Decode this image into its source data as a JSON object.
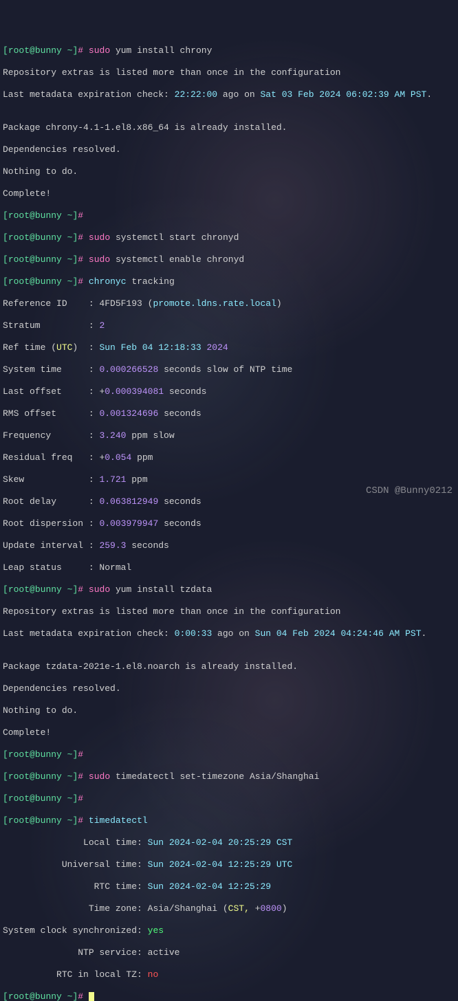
{
  "prompt": {
    "user": "root",
    "host": "bunny",
    "dir": "~",
    "mark": "#"
  },
  "cmd1": {
    "sudo": "sudo",
    "rest": " yum install chrony"
  },
  "out1": {
    "l1": "Repository extras is listed more than once in the configuration",
    "l2a": "Last metadata expiration check: ",
    "l2b": "22:22:00",
    "l2c": " ago on ",
    "l2d": "Sat 03 Feb 2024 06:02:39 AM PST",
    "l2e": ".",
    "l3": "",
    "l4": "Package chrony-4.1-1.el8.x86_64 is already installed.",
    "l5": "Dependencies resolved.",
    "l6": "Nothing to do.",
    "l7": "Complete!"
  },
  "cmd2": {
    "sudo": "sudo",
    "rest": " systemctl start chronyd"
  },
  "cmd3": {
    "sudo": "sudo",
    "rest": " systemctl enable chronyd"
  },
  "cmd4": {
    "name": "chronyc",
    "rest": " tracking"
  },
  "track": {
    "r1k": "Reference ID    ",
    "r1v1": ": 4FD5F193 (",
    "r1v2": "promote.ldns.rate.local",
    "r1v3": ")",
    "r2k": "Stratum         ",
    "r2v": ": ",
    "r2n": "2",
    "r3k": "Ref time (",
    "r3utc": "UTC",
    "r3k2": ")  : ",
    "r3a": "Sun Feb 04 12:18:33",
    "r3b": " ",
    "r3y": "2024",
    "r4k": "System time     : ",
    "r4n": "0.000266528",
    "r4r": " seconds slow of NTP time",
    "r5k": "Last offset     : ",
    "r5p": "+",
    "r5n": "0.000394081",
    "r5r": " seconds",
    "r6k": "RMS offset      : ",
    "r6n": "0.001324696",
    "r6r": " seconds",
    "r7k": "Frequency       : ",
    "r7n": "3.240",
    "r7r": " ppm slow",
    "r8k": "Residual freq   : ",
    "r8p": "+",
    "r8n": "0.054",
    "r8r": " ppm",
    "r9k": "Skew            : ",
    "r9n": "1.721",
    "r9r": " ppm",
    "r10k": "Root delay      : ",
    "r10n": "0.063812949",
    "r10r": " seconds",
    "r11k": "Root dispersion : ",
    "r11n": "0.003979947",
    "r11r": " seconds",
    "r12k": "Update interval : ",
    "r12n": "259.3",
    "r12r": " seconds",
    "r13k": "Leap status     ",
    "r13v": ": Normal"
  },
  "cmd5": {
    "sudo": "sudo",
    "rest": " yum install tzdata"
  },
  "out5": {
    "l1": "Repository extras is listed more than once in the configuration",
    "l2a": "Last metadata expiration check: ",
    "l2b": "0:00:33",
    "l2c": " ago on ",
    "l2d": "Sun 04 Feb 2024 04:24:46 AM PST",
    "l2e": ".",
    "l3": "",
    "l4": "Package tzdata-2021e-1.el8.noarch is already installed.",
    "l5": "Dependencies resolved.",
    "l6": "Nothing to do.",
    "l7": "Complete!"
  },
  "cmd6": {
    "sudo": "sudo",
    "rest": " timedatectl set-timezone Asia/Shanghai"
  },
  "cmd7": {
    "name": "timedatectl"
  },
  "tdc": {
    "l1k": "               Local time: ",
    "l1v": "Sun 2024-02-04 20:25:29 CST",
    "l2k": "           Universal time: ",
    "l2v": "Sun 2024-02-04 12:25:29 UTC",
    "l3k": "                 RTC time: ",
    "l3v": "Sun 2024-02-04 12:25:29",
    "l4k": "                Time zone: ",
    "l4a": "Asia/Shanghai (",
    "l4b": "CST,",
    "l4c": " +",
    "l4d": "0800",
    "l4e": ")",
    "l5k": "System clock synchronized: ",
    "l5v": "yes",
    "l6k": "              NTP service: ",
    "l6v": "active",
    "l7k": "          RTC in local TZ: ",
    "l7v": "no"
  },
  "watermark": "CSDN @Bunny0212"
}
